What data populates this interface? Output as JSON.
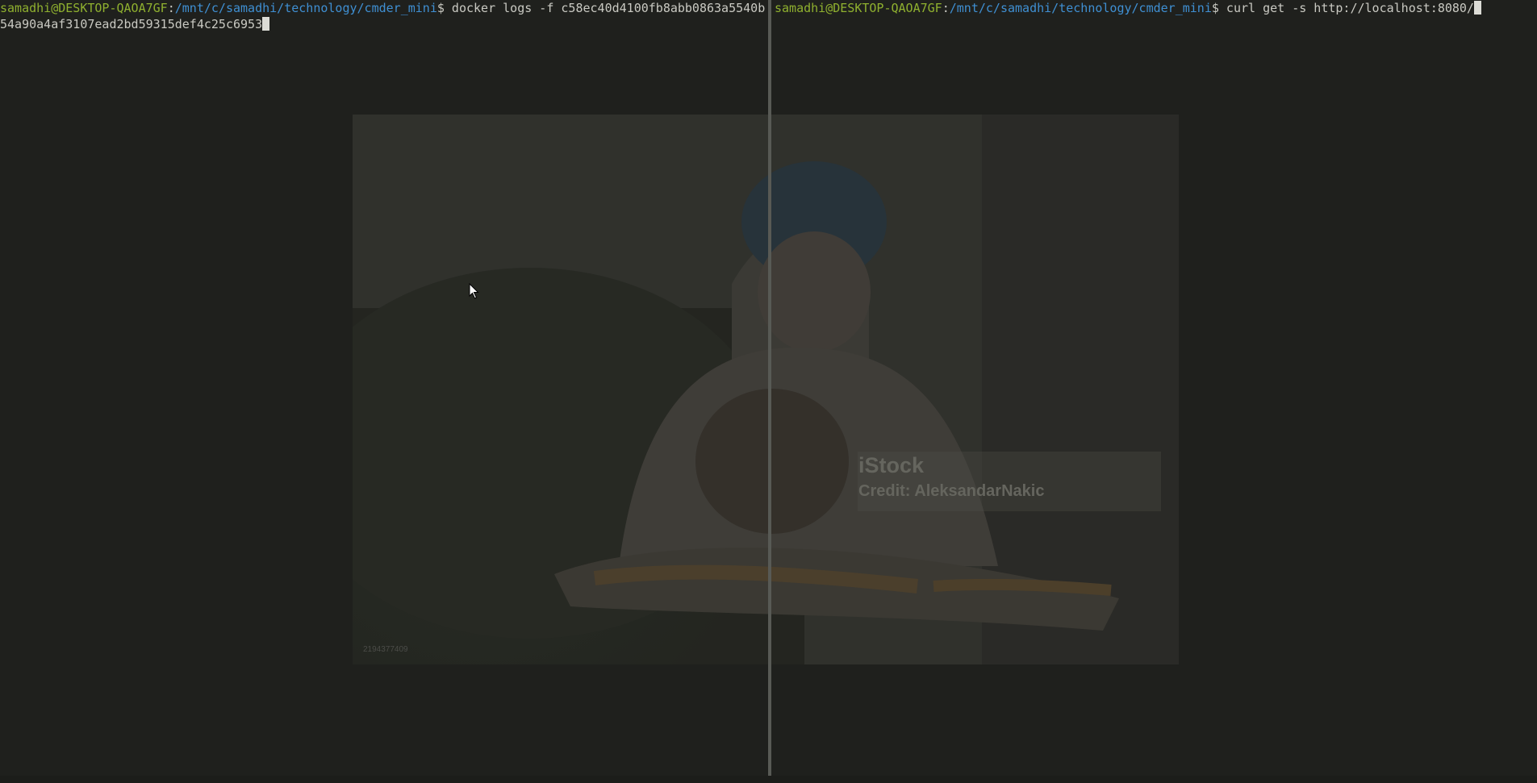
{
  "left_pane": {
    "user_host": "samadhi@DESKTOP-QAOA7GF",
    "separator": ":",
    "cwd": "/mnt/c/samadhi/technology/cmder_mini",
    "prompt_symbol": "$",
    "command": " docker logs -f c58ec40d4100fb8abb0863a5540b",
    "output": "54a90a4af3107ead2bd59315def4c25c6953"
  },
  "right_pane": {
    "user_host": "samadhi@DESKTOP-QAOA7GF",
    "separator": ":",
    "cwd": "/mnt/c/samadhi/technology/cmder_mini",
    "prompt_symbol": "$",
    "command": " curl get -s http://localhost:8080/"
  },
  "overlay": {
    "watermark_brand": "iStock",
    "watermark_credit": "Credit: AleksandarNakic",
    "image_id": "2194377409"
  },
  "colors": {
    "background": "#1f201d",
    "user_host": "#8fb02f",
    "path": "#3f8fd2",
    "text": "#c9c9c2"
  }
}
